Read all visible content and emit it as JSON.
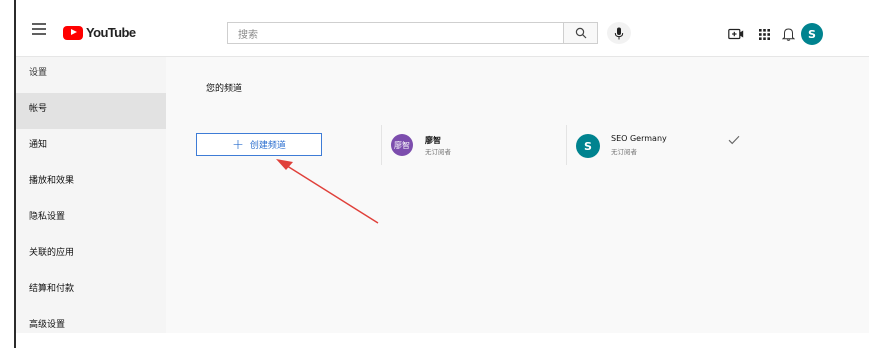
{
  "header": {
    "logo_text": "YouTube",
    "search_placeholder": "搜索",
    "avatar_letter": "S"
  },
  "sidebar": {
    "items": [
      {
        "label": "设置"
      },
      {
        "label": "帐号"
      },
      {
        "label": "通知"
      },
      {
        "label": "播放和效果"
      },
      {
        "label": "隐私设置"
      },
      {
        "label": "关联的应用"
      },
      {
        "label": "结算和付款"
      },
      {
        "label": "高级设置"
      }
    ]
  },
  "main": {
    "title": "您的频道",
    "create_button_label": "创建频道",
    "channels": [
      {
        "avatar_text": "廖智",
        "name": "廖智",
        "subscribers": "无订阅者",
        "avatar_color": "#7c4dad"
      },
      {
        "avatar_text": "S",
        "name": "SEO Germany",
        "subscribers": "无订阅者",
        "avatar_color": "#00838f"
      }
    ],
    "selected_channel_mark": "✓"
  },
  "colors": {
    "youtube_red": "#ff0000",
    "accent_blue": "#3e7cd6",
    "annotation_arrow": "#e0403a"
  }
}
